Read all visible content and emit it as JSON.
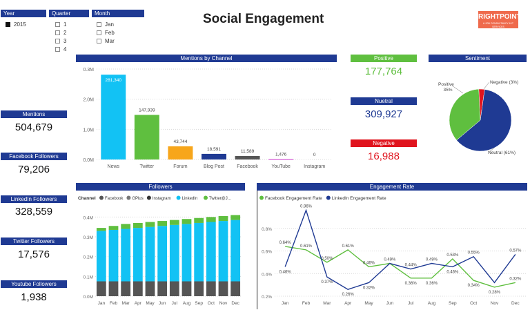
{
  "page_title": "Social Engagement",
  "logo": {
    "name": "RIGHTPOINT",
    "tagline": "A JOB CONSULTANCY & IT SERVICES"
  },
  "slicers": {
    "year": {
      "title": "Year",
      "items": [
        {
          "label": "2015",
          "checked": true
        }
      ]
    },
    "quarter": {
      "title": "Quarter",
      "items": [
        {
          "label": "1"
        },
        {
          "label": "2"
        },
        {
          "label": "3"
        },
        {
          "label": "4"
        }
      ]
    },
    "month": {
      "title": "Month",
      "items": [
        {
          "label": "Jan"
        },
        {
          "label": "Feb"
        },
        {
          "label": "Mar"
        }
      ]
    }
  },
  "kpis": [
    {
      "title": "Mentions",
      "value": "504,679"
    },
    {
      "title": "Facebook Followers",
      "value": "79,206"
    },
    {
      "title": "LinkedIn Followers",
      "value": "328,559"
    },
    {
      "title": "Twitter Followers",
      "value": "17,576"
    },
    {
      "title": "Youtube Followers",
      "value": "1,938"
    }
  ],
  "sentiment_cards": [
    {
      "title": "Positive",
      "value": "177,764",
      "color": "#5fbf3f"
    },
    {
      "title": "Nuetral",
      "value": "309,927",
      "color": "#1f3a93"
    },
    {
      "title": "Negative",
      "value": "16,988",
      "color": "#e0141e"
    }
  ],
  "colors": {
    "header": "#1f3a93",
    "positive": "#5fbf3f",
    "neutral": "#1f3a93",
    "negative": "#e0141e",
    "logo": "#ef6a4c",
    "gridline": "#d9d9d9"
  },
  "chart_data": [
    {
      "id": "mentions",
      "type": "bar",
      "title": "Mentions by Channel",
      "categories": [
        "News",
        "Twitter",
        "Forum",
        "Blog Post",
        "Facebook",
        "YouTube",
        "Instagram"
      ],
      "values": [
        281340,
        147939,
        43744,
        18591,
        11589,
        1476,
        0
      ],
      "value_labels": [
        "281,340",
        "147,939",
        "43,744",
        "18,591",
        "11,589",
        "1,476",
        "0"
      ],
      "colors": [
        "#12c2f4",
        "#5fbf3f",
        "#f7a61b",
        "#1f3a93",
        "#555555",
        "#cc33cc",
        "#cccccc"
      ],
      "ylim": [
        0,
        300000
      ],
      "yticks": [
        0,
        100000,
        200000,
        300000
      ],
      "ytick_labels": [
        "0.0M",
        "1.0M",
        "2.0M",
        "0.3M"
      ],
      "grid": true
    },
    {
      "id": "sentiment",
      "type": "pie",
      "title": "Sentiment",
      "slices": [
        {
          "label": "Positive",
          "pct_label": "35%",
          "value": 35,
          "color": "#5fbf3f"
        },
        {
          "label": "Neutral (61%)",
          "pct_label": "",
          "value": 61,
          "color": "#1f3a93"
        },
        {
          "label": "Negative (3%)",
          "pct_label": "",
          "value": 3,
          "color": "#e0141e"
        }
      ]
    },
    {
      "id": "followers",
      "type": "bar",
      "stacked": true,
      "title": "Followers",
      "legend_title": "Channel",
      "legend_position": "top-left",
      "categories": [
        "Jan",
        "Feb",
        "Mar",
        "Apr",
        "May",
        "Jun",
        "Jul",
        "Aug",
        "Sep",
        "Oct",
        "Nov",
        "Dec"
      ],
      "series": [
        {
          "name": "Facebook",
          "color": "#555555",
          "values": [
            0.075,
            0.075,
            0.075,
            0.075,
            0.075,
            0.075,
            0.075,
            0.075,
            0.075,
            0.075,
            0.075,
            0.075
          ]
        },
        {
          "name": "GPlus",
          "color": "#777777",
          "values": [
            0,
            0,
            0,
            0,
            0,
            0,
            0,
            0,
            0,
            0,
            0,
            0
          ]
        },
        {
          "name": "Instagram",
          "color": "#333333",
          "values": [
            0,
            0,
            0,
            0,
            0,
            0,
            0,
            0,
            0,
            0,
            0,
            0
          ]
        },
        {
          "name": "LinkedIn",
          "color": "#12c2f4",
          "values": [
            0.255,
            0.26,
            0.265,
            0.27,
            0.275,
            0.28,
            0.285,
            0.29,
            0.295,
            0.3,
            0.305,
            0.31
          ]
        },
        {
          "name": "Twitter@J...",
          "color": "#5fbf3f",
          "values": [
            0.015,
            0.02,
            0.025,
            0.025,
            0.025,
            0.025,
            0.025,
            0.025,
            0.025,
            0.025,
            0.025,
            0.025
          ]
        }
      ],
      "ylim": [
        0,
        0.45
      ],
      "yticks": [
        0,
        0.1,
        0.2,
        0.3,
        0.4
      ],
      "ytick_labels": [
        "0.0M",
        "0.1M",
        "0.2M",
        "0.3M",
        "0.4M"
      ],
      "grid": true
    },
    {
      "id": "engagement",
      "type": "line",
      "title": "Engagement Rate",
      "legend_position": "top-left",
      "categories": [
        "Jan",
        "Feb",
        "Mar",
        "Apr",
        "May",
        "Jun",
        "Jul",
        "Aug",
        "Sep",
        "Oct",
        "Nov",
        "Dec"
      ],
      "series": [
        {
          "name": "Facebook Engagement Rate",
          "color": "#5fbf3f",
          "values": [
            0.64,
            0.61,
            0.5,
            0.61,
            0.46,
            0.49,
            0.36,
            0.36,
            0.53,
            0.34,
            0.28,
            0.32
          ],
          "labels": [
            "0.64%",
            "0.61%",
            "0.50%",
            "0.61%",
            "0.46%",
            "0.49%",
            "0.36%",
            "0.36%",
            "0.53%",
            "0.34%",
            "0.28%",
            "0.32%"
          ]
        },
        {
          "name": "LinkedIn Engagement Rate",
          "color": "#1f3a93",
          "values": [
            0.46,
            0.96,
            0.37,
            0.26,
            0.32,
            0.49,
            0.44,
            0.49,
            0.46,
            0.55,
            0.32,
            0.57
          ],
          "labels": [
            "0.46%",
            "0.96%",
            "0.37%",
            "0.26%",
            "0.32%",
            "",
            "0.44%",
            "0.49%",
            "0.46%",
            "0.55%",
            "",
            "0.57%"
          ]
        }
      ],
      "ylim": [
        0.2,
        1.0
      ],
      "yticks": [
        0.2,
        0.4,
        0.6,
        0.8
      ],
      "ytick_labels": [
        "0.2%",
        "0.4%",
        "0.6%",
        "0.8%"
      ],
      "grid": true
    }
  ]
}
